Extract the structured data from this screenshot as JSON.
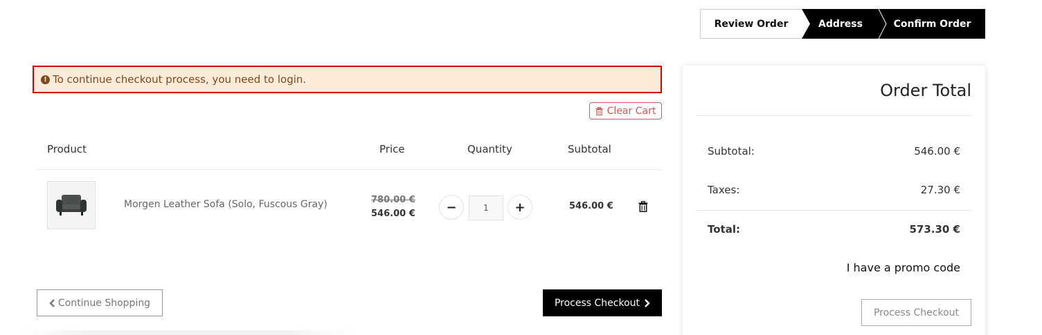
{
  "steps": [
    {
      "label": "Review Order"
    },
    {
      "label": "Address"
    },
    {
      "label": "Confirm Order"
    }
  ],
  "alert": {
    "message": "To continue checkout process, you need to login.",
    "icon": "exclamation-circle-icon",
    "icon_glyph": "!",
    "background": "#fcebd9",
    "border_color": "#d60000"
  },
  "clear_cart": {
    "label": "Clear Cart",
    "icon": "trash-icon"
  },
  "table": {
    "headers": {
      "product": "Product",
      "price": "Price",
      "quantity": "Quantity",
      "subtotal": "Subtotal"
    },
    "rows": [
      {
        "name": "Morgen Leather Sofa (Solo, Fuscous Gray)",
        "old_price": "780.00 €",
        "price": "546.00 €",
        "quantity": "1",
        "subtotal": "546.00 €",
        "decrement_glyph": "−",
        "increment_glyph": "+"
      }
    ]
  },
  "buttons": {
    "continue_shopping": "Continue Shopping",
    "process_checkout": "Process Checkout"
  },
  "order_total": {
    "title": "Order Total",
    "subtotal_label": "Subtotal:",
    "subtotal_value": "546.00 €",
    "taxes_label": "Taxes:",
    "taxes_value": "27.30 €",
    "total_label": "Total:",
    "total_value": "573.30 €",
    "promo_label": "I have a promo code",
    "checkout_label": "Process Checkout"
  }
}
